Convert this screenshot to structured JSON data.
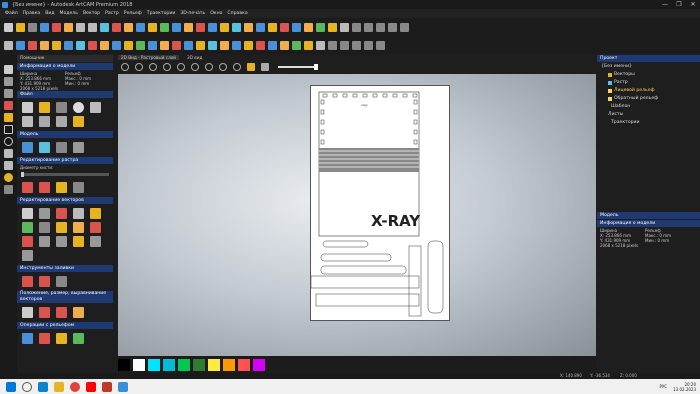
{
  "titlebar": {
    "title": "{Без имени} - Autodesk ArtCAM Premium 2018",
    "minimize": "—",
    "maximize": "❐",
    "close": "✕"
  },
  "menu": [
    "Файл",
    "Правка",
    "Вид",
    "Модель",
    "Вектор",
    "Растр",
    "Рельеф",
    "Траектории",
    "3D-печать",
    "Окно",
    "Справка"
  ],
  "leftpanel": {
    "header": "Помощник",
    "sections": [
      "Информация о модели",
      "Файл",
      "Модель",
      "Редактирование растра",
      "Редактирование векторов",
      "Инструменты заливки",
      "Положение, размер, выравнивание векторов",
      "Операции с рельефом"
    ],
    "model_info": {
      "width_label": "Ширина",
      "relief_label": "Рельеф",
      "width_lines": [
        "X: 253.866 mm",
        "Y: 431.909 mm",
        "2068 x 5218 pixels"
      ],
      "relief_lines": [
        "Макс.: 0 mm",
        "Мин.: 0 mm"
      ]
    },
    "raster_hint": "Диаметр кисти:"
  },
  "view": {
    "tabs": [
      "2D Вид - Растровый слой",
      "3D вид"
    ],
    "sheet_logo": "X-RAY",
    "sheet_small_text": "xray"
  },
  "rightpanel": {
    "header": "Проект",
    "tree": [
      {
        "label": "{Без имени}",
        "expanded": true
      },
      {
        "label": "Векторы"
      },
      {
        "label": "Растр"
      },
      {
        "label": "Лицевой рельеф",
        "highlight": true
      },
      {
        "label": "Обратный рельеф"
      },
      {
        "label": "Шаблон"
      },
      {
        "label": "Листы"
      },
      {
        "label": "Траектории"
      }
    ],
    "model_header": "Модель",
    "info_header": "Информация о модели",
    "info": {
      "width_label": "Ширина",
      "relief_label": "Рельеф",
      "width_lines": [
        "X: 253.866 mm",
        "Y: 431.909 mm",
        "2068 x 5218 pixels"
      ],
      "relief_lines": [
        "Макс.: 0 mm",
        "Мин.: 0 mm"
      ]
    }
  },
  "palette": {
    "colors": [
      "#000000",
      "#ffffff",
      "#00e5ff",
      "#00bcd4",
      "#00c853",
      "#2e7d32",
      "#ffeb3b",
      "#ff9800",
      "#ff5252",
      "#d500f9"
    ]
  },
  "status": {
    "x": "X: 140.890",
    "y": "Y: -36.534",
    "z": "Z: 0.000"
  },
  "taskbar": {
    "time": "20:20",
    "date": "13.02.2023",
    "lang": "РУС"
  },
  "accent": "#1f3a73"
}
